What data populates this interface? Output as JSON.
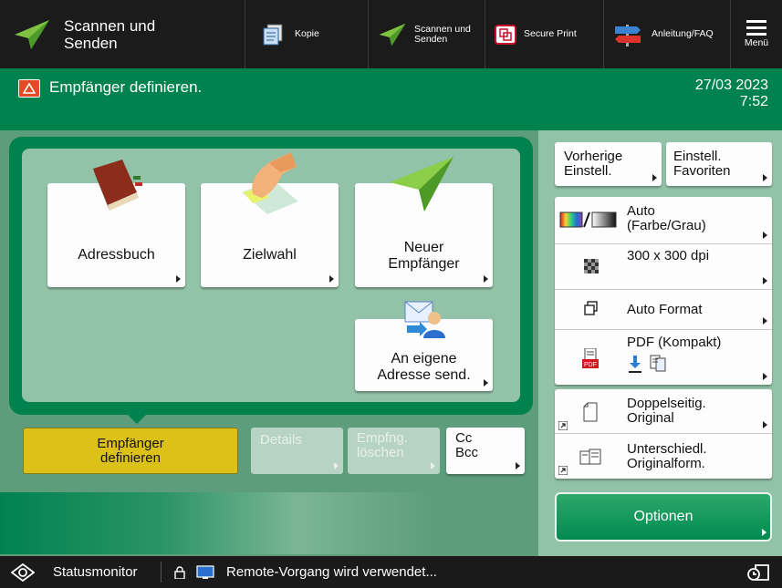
{
  "topbar": {
    "main_label": "Scannen und\nSenden",
    "items": [
      {
        "label": "Kopie",
        "icon": "copy-icon"
      },
      {
        "label": "Scannen und\nSenden",
        "icon": "scan-send-icon"
      },
      {
        "label": "Secure Print",
        "icon": "secure-print-icon"
      },
      {
        "label": "Anleitung/FAQ",
        "icon": "signpost-icon"
      }
    ],
    "menu_label": "Menü"
  },
  "status": {
    "message": "Empfänger definieren.",
    "date": "27/03 2023",
    "time": "7:52"
  },
  "destinations": {
    "adressbuch": "Adressbuch",
    "zielwahl": "Zielwahl",
    "neuer": "Neuer\nEmpfänger",
    "eigene": "An eigene\nAdresse send."
  },
  "bottom_buttons": {
    "empfaenger": "Empfänger\ndefinieren",
    "details": "Details",
    "loeschen": "Empfng.\nlöschen",
    "ccbcc": "Cc\nBcc"
  },
  "right": {
    "vorherige": "Vorherige\nEinstell.",
    "favoriten": "Einstell.\nFavoriten",
    "color": "Auto\n(Farbe/Grau)",
    "resolution": "300 x 300 dpi",
    "format": "Auto Format",
    "filetype": "PDF (Kompakt)",
    "duplex": "Doppelseitig.\nOriginal",
    "mixed": "Unterschiedl.\nOriginalform.",
    "options": "Optionen"
  },
  "footer": {
    "statusmonitor": "Statusmonitor",
    "remote": "Remote-Vorgang wird verwendet..."
  },
  "colors": {
    "green": "#00824f",
    "panel": "#92c3a8",
    "yellow": "#dcc118",
    "topbar": "#1b1b1b"
  }
}
